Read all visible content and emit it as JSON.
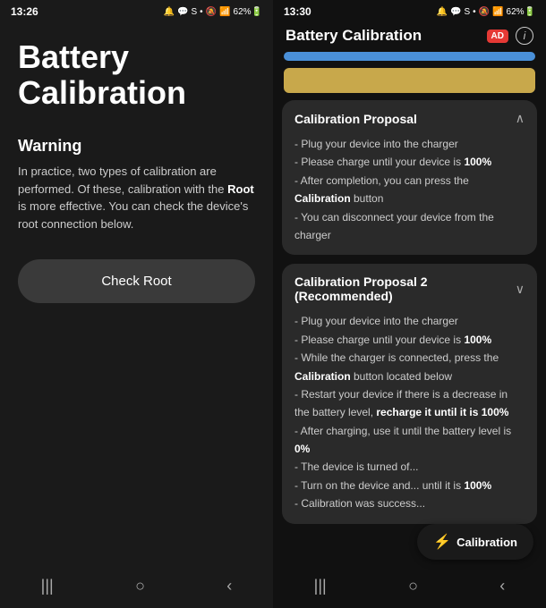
{
  "left": {
    "statusBar": {
      "time": "13:26",
      "icons": "🔔 S •"
    },
    "appTitle": "Battery\nCalibration",
    "warning": {
      "title": "Warning",
      "text1": "In practice, two types of calibration are performed. Of these, calibration with the Root is more effective. You can check the device's root connection below.",
      "rootBoldLabel": "Root"
    },
    "checkRootBtn": "Check Root",
    "navIcons": [
      "|||",
      "○",
      "<"
    ]
  },
  "right": {
    "statusBar": {
      "time": "13:30",
      "icons": "🔔 S •"
    },
    "headerTitle": "Battery Calibration",
    "adLabel": "AD",
    "infoLabel": "i",
    "proposal1": {
      "title": "Calibration Proposal",
      "chevron": "∧",
      "lines": [
        "- Plug your device into the charger",
        "- Please charge until your device is 100%",
        "- After completion, you can press the Calibration button",
        "- You can disconnect your device from the charger"
      ],
      "boldWords": [
        "100%",
        "Calibration"
      ]
    },
    "proposal2": {
      "title": "Calibration Proposal 2\n(Recommended)",
      "chevron": "∨",
      "lines": [
        "- Plug your device into the charger",
        "- Please charge until your device is 100%",
        "- While the charger is connected, press the Calibration button located below",
        "- Restart your device if there is a decrease in the battery level, recharge it until it is 100%",
        "- After charging, use it until the battery level is 0%",
        "- The device is turned of...",
        "- Turn on the device and... until it is 100%",
        "- Calibration was success..."
      ],
      "boldWords": [
        "100%",
        "Calibration",
        "recharge it until it is 100%",
        "0%",
        "100%"
      ]
    },
    "calibrationBtn": "Calibration",
    "navIcons": [
      "|||",
      "○",
      "<"
    ]
  }
}
